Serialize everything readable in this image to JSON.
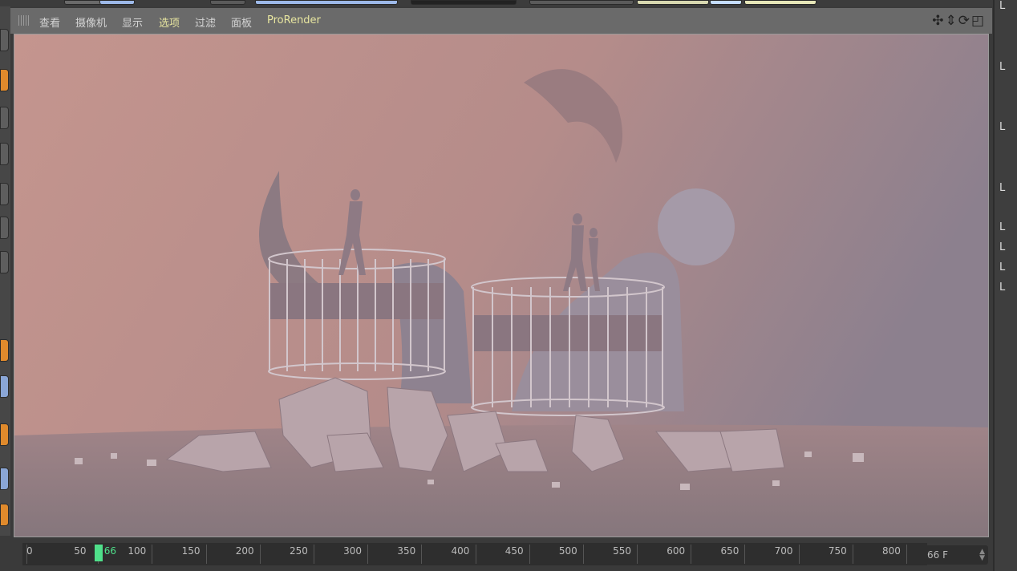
{
  "viewport_menu": [
    {
      "label": "查看",
      "highlight": false
    },
    {
      "label": "摄像机",
      "highlight": false
    },
    {
      "label": "显示",
      "highlight": false
    },
    {
      "label": "选项",
      "highlight": true
    },
    {
      "label": "过滤",
      "highlight": false
    },
    {
      "label": "面板",
      "highlight": false
    },
    {
      "label": "ProRender",
      "highlight": true
    }
  ],
  "nav_icons": [
    "move-view-icon",
    "dolly-view-icon",
    "rotate-view-icon",
    "maximize-view-icon"
  ],
  "timeline": {
    "min": 0,
    "max": 800,
    "ticks": [
      "0",
      "50",
      "100",
      "150",
      "200",
      "250",
      "300",
      "350",
      "400",
      "450",
      "500",
      "550",
      "600",
      "650",
      "700",
      "750",
      "800"
    ],
    "current_frame": 66,
    "current_label": "66",
    "frame_field": "66 F"
  },
  "right_panel": {
    "items": [
      "L",
      "L",
      "L",
      "L",
      "L",
      "L",
      "L",
      "L"
    ]
  },
  "colors": {
    "accent_green": "#4fe08a",
    "highlight_text": "#e8e6a0"
  }
}
